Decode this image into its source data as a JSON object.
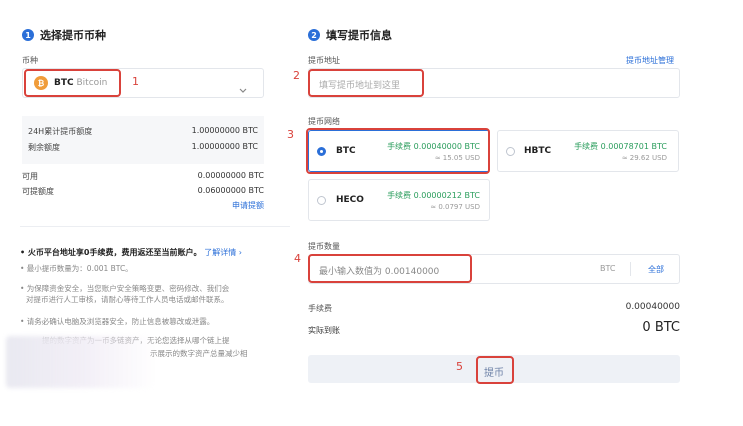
{
  "step1": {
    "num": "1",
    "title": "选择提币币种"
  },
  "step2": {
    "num": "2",
    "title": "填写提币信息"
  },
  "coin": {
    "label": "币种",
    "icon_glyph": "₿",
    "symbol": "BTC",
    "name": "Bitcoin",
    "dropdown_icon": "chevron-down"
  },
  "quota": {
    "rows": [
      {
        "label": "24H累计提币额度",
        "value": "1.00000000 BTC"
      },
      {
        "label": "剩余额度",
        "value": "1.00000000 BTC"
      }
    ]
  },
  "balance": {
    "rows": [
      {
        "label": "可用",
        "value": "0.00000000 BTC"
      },
      {
        "label": "可提额度",
        "value": "0.06000000 BTC"
      }
    ],
    "apply_link": "申请提额"
  },
  "notes": {
    "headline": "• 火币平台地址享0手续费，费用返还至当前账户。",
    "learn_more": "了解详情 ›",
    "min_amount": "• 最小提币数量为：0.001 BTC。",
    "security_1": "• 为保障资金安全，当您账户安全策略变更、密码修改、我们会",
    "security_2": "对提币进行人工审核，请耐心等待工作人员电话或邮件联系。",
    "device": "• 请务必确认电脑及浏览器安全，防止信息被篡改或泄露。",
    "blur_1": "提的数字资产为一币多链资产，无论您选择从哪个链上提",
    "blur_2": "示展示的数字资产总量减少相"
  },
  "address": {
    "label": "提币地址",
    "manage_link": "提币地址管理",
    "placeholder": "填写提币地址到这里"
  },
  "network": {
    "label": "提币网络",
    "options": [
      {
        "name": "BTC",
        "fee": "手续费 0.00040000 BTC",
        "usd": "≈ 15.05 USD",
        "selected": true
      },
      {
        "name": "HBTC",
        "fee": "手续费 0.00078701 BTC",
        "usd": "≈ 29.62 USD",
        "selected": false
      },
      {
        "name": "HECO",
        "fee": "手续费 0.00000212 BTC",
        "usd": "≈ 0.0797 USD",
        "selected": false
      }
    ]
  },
  "amount": {
    "label": "提币数量",
    "placeholder": "最小输入数值为 0.00140000",
    "unit": "BTC",
    "all": "全部"
  },
  "summary": {
    "fee_label": "手续费",
    "fee_value": "0.00040000",
    "received_label": "实际到账",
    "received_value": "0 BTC"
  },
  "submit_label": "提币",
  "annotations": [
    "1",
    "2",
    "3",
    "4",
    "5"
  ],
  "colors": {
    "accent": "#2b6fd8",
    "annotation": "#d9423b",
    "fee_green": "#2a9d5c",
    "coin_orange": "#f09c3a"
  }
}
